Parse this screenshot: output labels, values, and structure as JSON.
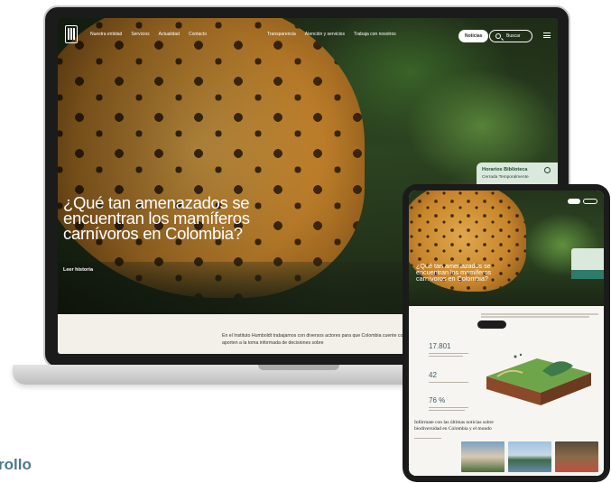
{
  "laptop": {
    "nav": {
      "links_left": [
        "Nuestra entidad",
        "Servicios",
        "Actualidad",
        "Contacto"
      ],
      "links_right": [
        "Transparencia",
        "Atención y servicios",
        "Trabaja con nosotros"
      ],
      "pill_label": "Noticias",
      "search_label": "Buscar"
    },
    "hero": {
      "title": "¿Qué tan amenazados se encuentran los mamíferos carnívoros en Colombia?",
      "author": "Leer historia"
    },
    "hours_card": {
      "title": "Horarios Biblioteca",
      "subtitle": "Cerrada Temporalmente"
    },
    "intro_text": "En el Instituto Humboldt trabajamos con diversos actores para que Colombia cuente con información sobre la biodiversidad que aporten a la toma informada de decisiones sobre"
  },
  "tablet": {
    "hero_title": "¿Qué tan amenazados se encuentran los mamíferos carnívoros en Colombia?",
    "stats": [
      "17.801",
      "42",
      "76 %"
    ],
    "headline": "Infórmate con las últimas noticias sobre biodiversidad en Colombia y el mundo"
  },
  "page": {
    "section_label": "rollo"
  },
  "colors": {
    "accent_green": "#234a35",
    "card_mint": "#dbe8dc",
    "label_blue": "#4a7a8a"
  }
}
